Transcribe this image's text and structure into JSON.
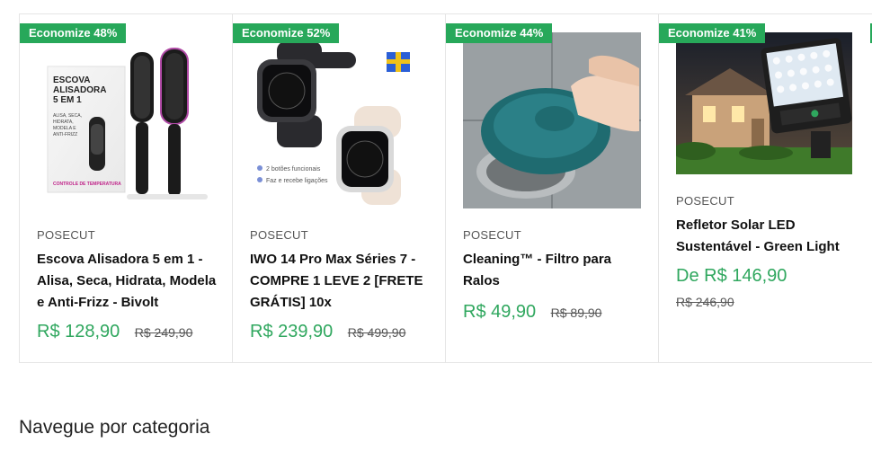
{
  "products": [
    {
      "badge": "Economize 48%",
      "vendor": "POSECUT",
      "title": "Escova Alisadora 5 em 1 - Alisa, Seca, Hidrata, Modela e Anti-Frizz - Bivolt",
      "price": "R$ 128,90",
      "compare_price": "R$ 249,90",
      "image_icon": "hair-straightener-brush-image",
      "box_text": [
        "ESCOVA",
        "ALISADORA",
        "5 EM 1"
      ],
      "box_features": [
        "ALISA, SECA,",
        "HIDRATA,",
        "MODELA E",
        "ANTI-FRIZZ"
      ],
      "box_footer": "CONTROLE DE TEMPERATURA"
    },
    {
      "badge": "Economize 52%",
      "vendor": "POSECUT",
      "title": "IWO 14 Pro Max Séries 7 - COMPRE 1 LEVE 2 [FRETE GRÁTIS] 10x",
      "price": "R$ 239,90",
      "compare_price": "R$ 499,90",
      "image_icon": "smartwatch-pair-image",
      "feature_1": "2 botões funcionais",
      "feature_2": "Faz e recebe ligações"
    },
    {
      "badge": "Economize 44%",
      "vendor": "POSECUT",
      "title": "Cleaning™ - Filtro para Ralos",
      "price": "R$ 49,90",
      "compare_price": "R$ 89,90",
      "image_icon": "drain-filter-image"
    },
    {
      "badge": "Economize 41%",
      "vendor": "POSECUT",
      "title": "Refletor Solar LED Sustentável - Green Light",
      "price": "De R$ 146,90",
      "compare_price": "R$ 246,90",
      "image_icon": "solar-led-light-image"
    }
  ],
  "section": {
    "title": "Navegue por categoria"
  },
  "colors": {
    "accent": "#27a85a",
    "price": "#2fa75e",
    "border": "#e5e5e5"
  }
}
